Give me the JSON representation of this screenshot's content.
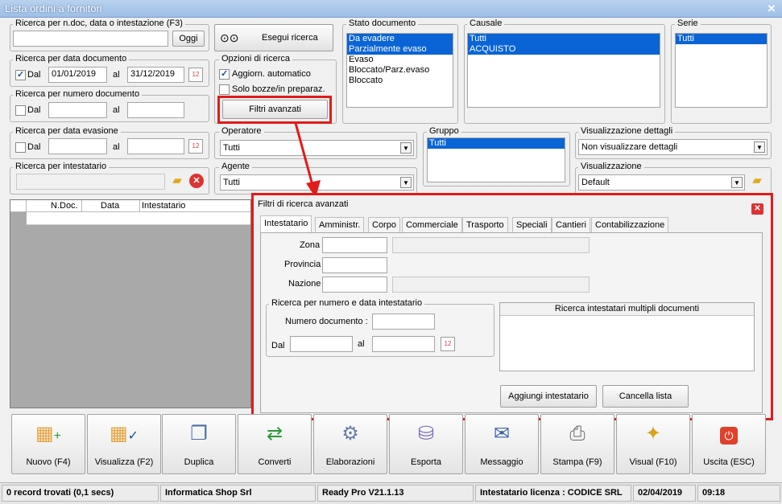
{
  "window": {
    "title": "Lista ordini a fornitori",
    "close": "✕"
  },
  "search_doc": {
    "label": "Ricerca per n.doc, data o intestazione (F3)",
    "value": "",
    "oggi": "Oggi",
    "exec": "Esegui ricerca"
  },
  "search_date": {
    "label": "Ricerca per data documento",
    "dal": "Dal",
    "from": "01/01/2019",
    "al": "al",
    "to": "31/12/2019"
  },
  "search_num": {
    "label": "Ricerca per numero documento",
    "dal": "Dal",
    "al": "al"
  },
  "search_evas": {
    "label": "Ricerca per data evasione",
    "dal": "Dal",
    "al": "al"
  },
  "search_int": {
    "label": "Ricerca per intestatario"
  },
  "options": {
    "label": "Opzioni di ricerca",
    "auto": "Aggiorn. automatico",
    "bozze": "Solo bozze/in preparaz.",
    "filtri": "Filtri avanzati"
  },
  "stato": {
    "label": "Stato documento",
    "items": [
      "Da evadere",
      "Parzialmente evaso",
      "Evaso",
      "Bloccato/Parz.evaso",
      "Bloccato"
    ]
  },
  "causale": {
    "label": "Causale",
    "items": [
      "Tutti",
      "ACQUISTO"
    ]
  },
  "serie": {
    "label": "Serie",
    "items": [
      "Tutti"
    ]
  },
  "operatore": {
    "label": "Operatore",
    "value": "Tutti"
  },
  "agente": {
    "label": "Agente",
    "value": "Tutti"
  },
  "gruppo": {
    "label": "Gruppo",
    "items": [
      "Tutti"
    ]
  },
  "dettagli": {
    "label": "Visualizzazione dettagli",
    "value": "Non visualizzare dettagli"
  },
  "visual": {
    "label": "Visualizzazione",
    "value": "Default"
  },
  "grid": {
    "headers": [
      "N.Doc.",
      "Data",
      "Intestatario"
    ]
  },
  "adv": {
    "title": "Filtri di ricerca avanzati",
    "tabs": [
      "Intestatario",
      "Amministr.",
      "Corpo",
      "Commerciale",
      "Trasporto",
      "Speciali",
      "Cantieri",
      "Contabilizzazione"
    ],
    "zona": "Zona",
    "provincia": "Provincia",
    "nazione": "Nazione",
    "group": "Ricerca per numero e data intestatario",
    "numdoc": "Numero documento :",
    "dal": "Dal",
    "al": "al",
    "multi": "Ricerca intestatari multipli documenti",
    "add": "Aggiungi intestatario",
    "clear": "Cancella lista"
  },
  "toolbar": [
    {
      "label": "Nuovo (F4)",
      "icon": "new-icon"
    },
    {
      "label": "Visualizza (F2)",
      "icon": "view-icon"
    },
    {
      "label": "Duplica",
      "icon": "duplicate-icon"
    },
    {
      "label": "Converti",
      "icon": "convert-icon"
    },
    {
      "label": "Elaborazioni",
      "icon": "process-icon"
    },
    {
      "label": "Esporta",
      "icon": "export-icon"
    },
    {
      "label": "Messaggio",
      "icon": "message-icon"
    },
    {
      "label": "Stampa (F9)",
      "icon": "print-icon"
    },
    {
      "label": "Visual (F10)",
      "icon": "wand-icon"
    },
    {
      "label": "Uscita (ESC)",
      "icon": "exit-icon"
    }
  ],
  "status": {
    "records": "0 record trovati (0,1 secs)",
    "company": "Informatica Shop Srl",
    "version": "Ready Pro V21.1.13",
    "license": "Intestatario licenza : CODICE SRL",
    "date": "02/04/2019",
    "time": "09:18"
  },
  "colors": {
    "highlight": "#e21b1b",
    "selection": "#0a64d6"
  }
}
